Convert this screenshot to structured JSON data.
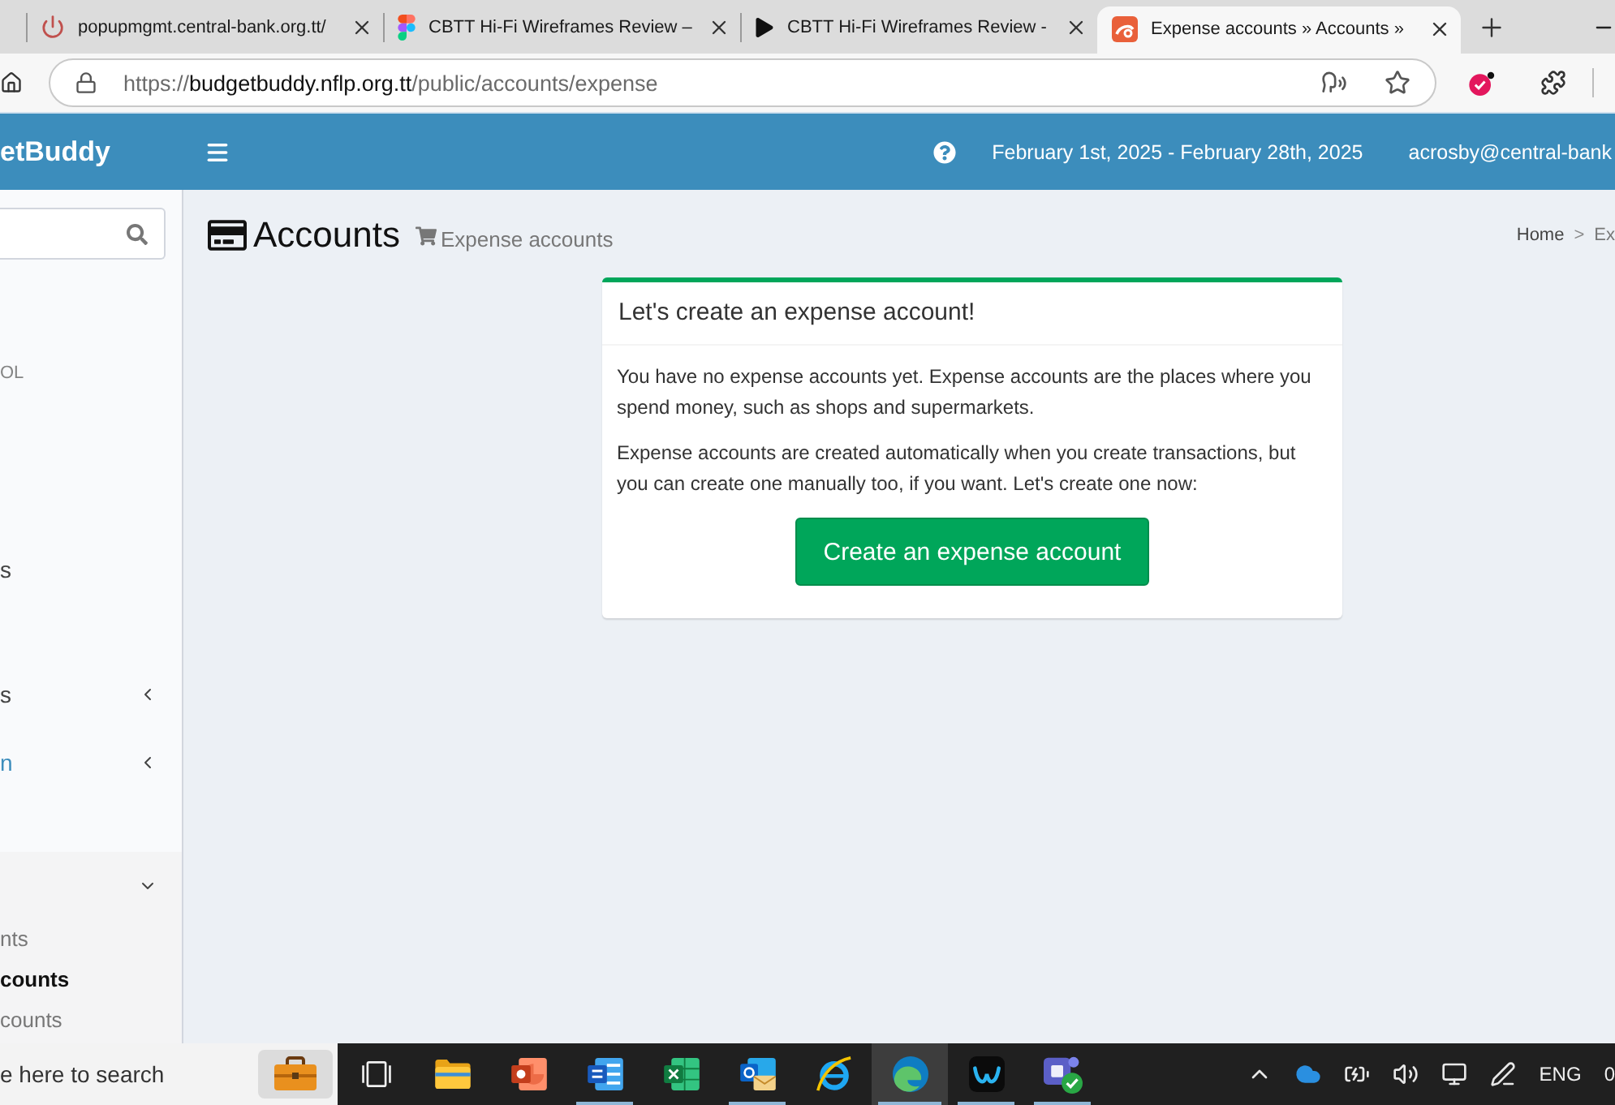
{
  "browser": {
    "tabs": [
      {
        "kind": "power",
        "title": "popupmgmt.central-bank.org.tt/",
        "selected": false
      },
      {
        "kind": "figma",
        "title": "CBTT Hi-Fi Wireframes Review –",
        "selected": false
      },
      {
        "kind": "play",
        "title": "CBTT Hi-Fi Wireframes Review -",
        "selected": false
      },
      {
        "kind": "site",
        "title": "Expense accounts » Accounts »",
        "selected": true
      }
    ],
    "address": {
      "scheme": "https://",
      "host": "budgetbuddy.nflp.org.tt",
      "path": "/public/accounts/expense"
    }
  },
  "header": {
    "logo": "etBuddy",
    "date_range": "February 1st, 2025 - February 28th, 2025",
    "user": "acrosby@central-bank"
  },
  "sidebar": {
    "section_header": "OL",
    "items": [
      {
        "kind": "link",
        "label": "s",
        "hovered": false
      },
      {
        "kind": "tree",
        "label": "s",
        "hovered": false,
        "expanded": false
      },
      {
        "kind": "tree",
        "label": "n",
        "hovered": true,
        "expanded": false
      },
      {
        "kind": "tree",
        "hovered": false,
        "expanded": true,
        "children": [
          {
            "label": "nts",
            "selected": false
          },
          {
            "label": "counts",
            "selected": true
          },
          {
            "label": "counts",
            "selected": false
          }
        ]
      }
    ]
  },
  "page": {
    "title": "Accounts",
    "subtitle": "Expense accounts",
    "breadcrumb": {
      "items": [
        "Home",
        "Ex"
      ],
      "separator": ">"
    }
  },
  "card": {
    "title": "Let's create an expense account!",
    "paragraphs": [
      "You have no expense accounts yet. Expense accounts are the places where you spend money, such as shops and supermarkets.",
      "Expense accounts are created automatically when you create transactions, but you can create one manually too, if you want. Let's create one now:"
    ],
    "button": "Create an expense account"
  },
  "taskbar": {
    "search": {
      "placeholder": "e here to search"
    },
    "apps": [
      {
        "kind": "task-view",
        "running": false,
        "active": false
      },
      {
        "kind": "folder",
        "running": false,
        "active": false
      },
      {
        "kind": "slides",
        "running": false,
        "active": false
      },
      {
        "kind": "doc",
        "running": true,
        "active": false
      },
      {
        "kind": "sheet",
        "running": false,
        "active": false
      },
      {
        "kind": "mail",
        "running": true,
        "active": false
      },
      {
        "kind": "globe",
        "running": false,
        "active": false
      },
      {
        "kind": "browser",
        "running": true,
        "active": true
      },
      {
        "kind": "meeting",
        "running": true,
        "active": false
      },
      {
        "kind": "chat",
        "running": true,
        "active": false
      }
    ],
    "tray": {
      "language": "ENG",
      "clock": "0"
    }
  }
}
